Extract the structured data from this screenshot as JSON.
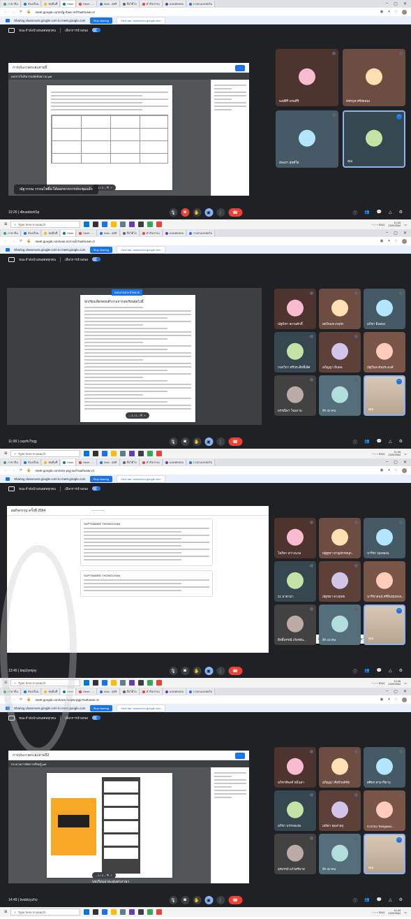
{
  "tabs": [
    "ภาษาจีน",
    "ห้องเรียน",
    "พหุจีนที่",
    "Meet",
    "Meet - ...",
    "Mail - สุทธิ",
    "สื่อวิดีโอ",
    "ตัวกิจกรรม",
    "แบบทดสอบ",
    "กรอกแบบฟอร์ม"
  ],
  "share_bar": {
    "text": "Sharing classroom.google.com to meet.google.com",
    "stop": "Stop sharing",
    "view": "View tab: classroom.google.com"
  },
  "meet_title": "ขณะกำลังนำเสนอต่อทุกคน",
  "meet_sub": "เลือกการนำเสนอ",
  "search_placeholder": "Type here to search",
  "shots": [
    {
      "url": "meet.google.com/zfg-rbwv-mif?authuser=0",
      "doc_title": "การประกวดระยะสามปี",
      "doc_file": "เอกสารใบกิจกรรมอัดข้อความ.pdf",
      "caption": "ณัฐวรรณ วรรณโพธิ์ม ได้ออกจากการประชุมแล้ว",
      "meeting_code": "10:26 | dbuadzekSp",
      "clock_time": "10:26",
      "clock_date": "23/9/2564",
      "tiles": [
        "พงษ์ศิริ พรมศิริ",
        "พัชรนุช ศรีอัยทอง",
        "อัจฉรา สุขดีใส",
        "คุณ"
      ]
    },
    {
      "url": "meet.google.com/vas-ncrt-sxb?authuser=0",
      "doc_title": "แบบงานประจำหน่วย",
      "doc_text": "นักเรียนเลือกตอบคำถามจากบทเรียนต่อไปนี้",
      "meeting_code": "11:08 | cvprfv7hqg",
      "clock_time": "11:08",
      "clock_date": "23/9/2564",
      "tiles": [
        "ณัฐนิชา สงวนศักดิ์",
        "สดใจนช เกษุจัก",
        "อภิชา อินทอง",
        "กนกวิภา ศรีประสิทธิ์เลิศ",
        "อภิญญา อินทอ",
        "ณัฐวิมล ตันประยงค์",
        "พรรณิษา โฉมงาม",
        "อีก 32 คน",
        "คุณ"
      ]
    },
    {
      "url": "meet.google.com/vko-pxjj-wvf?authuser=0",
      "doc_title": "ผลกิจกรรม ครั้งที่ 2564",
      "post_author": "SUPTHAWEE THONGCHAN",
      "toast_text": "สิทธิ์พรรณี สะท้อนเพสงค์สุนทร มาเข้ามาร่วม",
      "toast_link": "เปิดสิทธิ์",
      "meeting_code": "13:45 | bop2ymjvy",
      "clock_time": "13:45",
      "clock_date": "23/9/2564",
      "tiles": [
        "โสภิดา สว่างนวล",
        "ณัฐฐชา หาญจักรสนุก...",
        "ปาริชา พุ่มทองน",
        "21 มาดามา",
        "ณัฐชยา ดวงฤทย",
        "นาริชาสนน์ ศรีสินทุ่มพบบ...",
        "สิทธิ์พรรณี เกียรตัน...",
        "อีก 23 คน",
        "คุณ"
      ]
    },
    {
      "url": "meet.google.com/vwx-mapw-pgp?authuser=0",
      "doc_title": "การประกวดระยะสามปี2",
      "doc_file": "กระบวนการจัดการเรียนรู้.pdf",
      "slide_title": "บทเรียนอายะสุนทรภาษา",
      "meeting_code": "14:49 | bvsbtzyzho",
      "clock_time": "14:49",
      "clock_date": "23/9/2564",
      "tiles": [
        "อภิชาติพงศ์ หมิ่นสา",
        "อภิญญา ศิลปีวงค์ชัย",
        "ศศิพร สามาริยาบุ",
        "อภิชา บรรจงแจ่ม",
        "เยลิสา พุ่มสายสุ",
        "Corrina Tanigawa...",
        "สุรธรรม์ แก้วตรีมาส",
        "อีก 32 คน",
        "คุณ"
      ]
    }
  ]
}
